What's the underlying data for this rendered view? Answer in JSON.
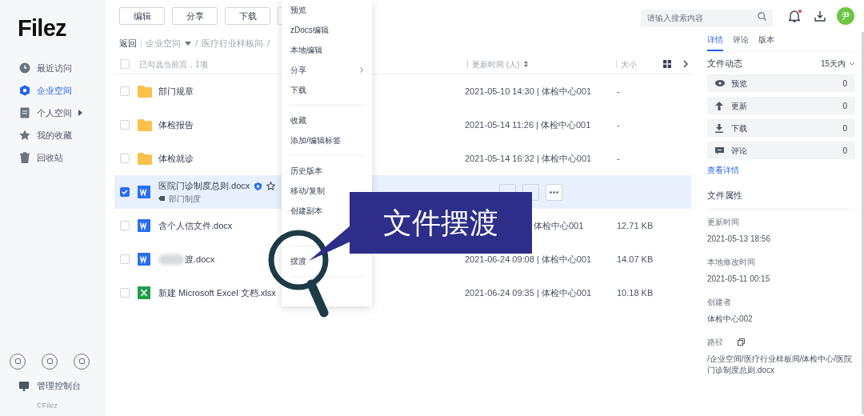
{
  "logo": "Filez",
  "sidebar": {
    "items": [
      {
        "label": "最近访问",
        "selected": false
      },
      {
        "label": "企业空间",
        "selected": true
      },
      {
        "label": "个人空间",
        "selected": false,
        "has_arrow": true
      },
      {
        "label": "我的收藏",
        "selected": false
      },
      {
        "label": "回收站",
        "selected": false
      }
    ],
    "console": "管理控制台",
    "copyright": "©Filez"
  },
  "toolbar": {
    "buttons": [
      "编辑",
      "分享",
      "下载"
    ]
  },
  "breadcrumb": {
    "back": "返回",
    "items": [
      {
        "label": "企业空间",
        "separator": "/"
      },
      {
        "label": "医疗行业样板间",
        "separator": "/"
      }
    ]
  },
  "search": {
    "placeholder": "请输入搜索内容"
  },
  "avatar": "尹",
  "table": {
    "select_all_checked": false,
    "select_info": "已勾选当前页，1项",
    "columns": [
      "更新时间 (人)",
      "大小"
    ],
    "rows": [
      {
        "kind": "folder",
        "name": "部门规章",
        "checked": false,
        "selected": false,
        "updated": "2021-05-10 14:30 | 体检中心001",
        "size": "-"
      },
      {
        "kind": "folder",
        "name": "体检报告",
        "checked": false,
        "selected": false,
        "updated": "2021-05-14 11:26 | 体检中心001",
        "size": "-"
      },
      {
        "kind": "folder",
        "name": "体检就诊",
        "checked": false,
        "selected": false,
        "updated": "2021-05-14 16:32 | 体检中心001",
        "size": "-"
      },
      {
        "kind": "word",
        "name": "医院门诊制度总则.docx",
        "checked": true,
        "selected": true,
        "tag": "部门制度"
      },
      {
        "kind": "word",
        "name": "含个人信文件.docx",
        "checked": false,
        "selected": false,
        "updated": "体检中心001",
        "updated_covered": true,
        "size": "12.71 KB"
      },
      {
        "kind": "word",
        "name": "渡.docx",
        "redacted": true,
        "checked": false,
        "selected": false,
        "updated": "2021-06-24 09:08 | 体检中心001",
        "size": "14.07 KB"
      },
      {
        "kind": "excel",
        "name": "新建 Microsoft Excel 文档.xlsx",
        "checked": false,
        "selected": false,
        "updated": "2021-06-24 09:35 | 体检中心001",
        "size": "10.18 KB"
      }
    ]
  },
  "context_menu": {
    "groups": [
      [
        {
          "label": "预览"
        },
        {
          "label": "zDocs编辑"
        },
        {
          "label": "本地编辑"
        },
        {
          "label": "分享",
          "submenu": true
        },
        {
          "label": "下载"
        }
      ],
      [
        {
          "label": "收藏"
        },
        {
          "label": "添加/编辑标签"
        }
      ],
      [
        {
          "label": "历史版本"
        },
        {
          "label": "移动/复制"
        },
        {
          "label": "创建副本"
        }
      ],
      [
        {
          "label": "摆渡"
        }
      ]
    ]
  },
  "callout": "文件摆渡",
  "details": {
    "tabs": [
      {
        "label": "详情",
        "selected": true
      },
      {
        "label": "评论",
        "selected": false
      },
      {
        "label": "版本",
        "selected": false
      }
    ],
    "activity_title": "文件动态",
    "range": "15天内",
    "activity": [
      {
        "label": "预览",
        "count": "0"
      },
      {
        "label": "更新",
        "count": "0"
      },
      {
        "label": "下载",
        "count": "0"
      },
      {
        "label": "评论",
        "count": "0"
      }
    ],
    "view_more": "查看详情",
    "props_title": "文件属性",
    "props": [
      {
        "label": "更新时间",
        "value": "2021-05-13 18:56"
      },
      {
        "label": "本地修改时间",
        "value": "2021-05-11 00:15"
      },
      {
        "label": "创建者",
        "value": "体检中心002"
      },
      {
        "label": "路径",
        "value": "/企业空间/医疗行业样板间/体检中心/医院门诊制度总则.docx",
        "copy": true
      }
    ]
  }
}
